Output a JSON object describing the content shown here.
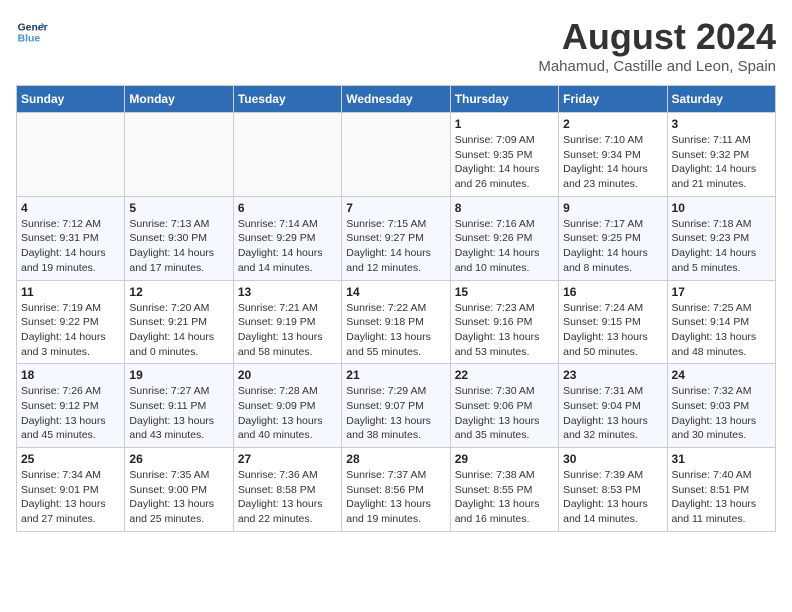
{
  "header": {
    "logo_line1": "General",
    "logo_line2": "Blue",
    "main_title": "August 2024",
    "subtitle": "Mahamud, Castille and Leon, Spain"
  },
  "weekdays": [
    "Sunday",
    "Monday",
    "Tuesday",
    "Wednesday",
    "Thursday",
    "Friday",
    "Saturday"
  ],
  "weeks": [
    [
      {
        "day": "",
        "info": ""
      },
      {
        "day": "",
        "info": ""
      },
      {
        "day": "",
        "info": ""
      },
      {
        "day": "",
        "info": ""
      },
      {
        "day": "1",
        "info": "Sunrise: 7:09 AM\nSunset: 9:35 PM\nDaylight: 14 hours\nand 26 minutes."
      },
      {
        "day": "2",
        "info": "Sunrise: 7:10 AM\nSunset: 9:34 PM\nDaylight: 14 hours\nand 23 minutes."
      },
      {
        "day": "3",
        "info": "Sunrise: 7:11 AM\nSunset: 9:32 PM\nDaylight: 14 hours\nand 21 minutes."
      }
    ],
    [
      {
        "day": "4",
        "info": "Sunrise: 7:12 AM\nSunset: 9:31 PM\nDaylight: 14 hours\nand 19 minutes."
      },
      {
        "day": "5",
        "info": "Sunrise: 7:13 AM\nSunset: 9:30 PM\nDaylight: 14 hours\nand 17 minutes."
      },
      {
        "day": "6",
        "info": "Sunrise: 7:14 AM\nSunset: 9:29 PM\nDaylight: 14 hours\nand 14 minutes."
      },
      {
        "day": "7",
        "info": "Sunrise: 7:15 AM\nSunset: 9:27 PM\nDaylight: 14 hours\nand 12 minutes."
      },
      {
        "day": "8",
        "info": "Sunrise: 7:16 AM\nSunset: 9:26 PM\nDaylight: 14 hours\nand 10 minutes."
      },
      {
        "day": "9",
        "info": "Sunrise: 7:17 AM\nSunset: 9:25 PM\nDaylight: 14 hours\nand 8 minutes."
      },
      {
        "day": "10",
        "info": "Sunrise: 7:18 AM\nSunset: 9:23 PM\nDaylight: 14 hours\nand 5 minutes."
      }
    ],
    [
      {
        "day": "11",
        "info": "Sunrise: 7:19 AM\nSunset: 9:22 PM\nDaylight: 14 hours\nand 3 minutes."
      },
      {
        "day": "12",
        "info": "Sunrise: 7:20 AM\nSunset: 9:21 PM\nDaylight: 14 hours\nand 0 minutes."
      },
      {
        "day": "13",
        "info": "Sunrise: 7:21 AM\nSunset: 9:19 PM\nDaylight: 13 hours\nand 58 minutes."
      },
      {
        "day": "14",
        "info": "Sunrise: 7:22 AM\nSunset: 9:18 PM\nDaylight: 13 hours\nand 55 minutes."
      },
      {
        "day": "15",
        "info": "Sunrise: 7:23 AM\nSunset: 9:16 PM\nDaylight: 13 hours\nand 53 minutes."
      },
      {
        "day": "16",
        "info": "Sunrise: 7:24 AM\nSunset: 9:15 PM\nDaylight: 13 hours\nand 50 minutes."
      },
      {
        "day": "17",
        "info": "Sunrise: 7:25 AM\nSunset: 9:14 PM\nDaylight: 13 hours\nand 48 minutes."
      }
    ],
    [
      {
        "day": "18",
        "info": "Sunrise: 7:26 AM\nSunset: 9:12 PM\nDaylight: 13 hours\nand 45 minutes."
      },
      {
        "day": "19",
        "info": "Sunrise: 7:27 AM\nSunset: 9:11 PM\nDaylight: 13 hours\nand 43 minutes."
      },
      {
        "day": "20",
        "info": "Sunrise: 7:28 AM\nSunset: 9:09 PM\nDaylight: 13 hours\nand 40 minutes."
      },
      {
        "day": "21",
        "info": "Sunrise: 7:29 AM\nSunset: 9:07 PM\nDaylight: 13 hours\nand 38 minutes."
      },
      {
        "day": "22",
        "info": "Sunrise: 7:30 AM\nSunset: 9:06 PM\nDaylight: 13 hours\nand 35 minutes."
      },
      {
        "day": "23",
        "info": "Sunrise: 7:31 AM\nSunset: 9:04 PM\nDaylight: 13 hours\nand 32 minutes."
      },
      {
        "day": "24",
        "info": "Sunrise: 7:32 AM\nSunset: 9:03 PM\nDaylight: 13 hours\nand 30 minutes."
      }
    ],
    [
      {
        "day": "25",
        "info": "Sunrise: 7:34 AM\nSunset: 9:01 PM\nDaylight: 13 hours\nand 27 minutes."
      },
      {
        "day": "26",
        "info": "Sunrise: 7:35 AM\nSunset: 9:00 PM\nDaylight: 13 hours\nand 25 minutes."
      },
      {
        "day": "27",
        "info": "Sunrise: 7:36 AM\nSunset: 8:58 PM\nDaylight: 13 hours\nand 22 minutes."
      },
      {
        "day": "28",
        "info": "Sunrise: 7:37 AM\nSunset: 8:56 PM\nDaylight: 13 hours\nand 19 minutes."
      },
      {
        "day": "29",
        "info": "Sunrise: 7:38 AM\nSunset: 8:55 PM\nDaylight: 13 hours\nand 16 minutes."
      },
      {
        "day": "30",
        "info": "Sunrise: 7:39 AM\nSunset: 8:53 PM\nDaylight: 13 hours\nand 14 minutes."
      },
      {
        "day": "31",
        "info": "Sunrise: 7:40 AM\nSunset: 8:51 PM\nDaylight: 13 hours\nand 11 minutes."
      }
    ]
  ]
}
